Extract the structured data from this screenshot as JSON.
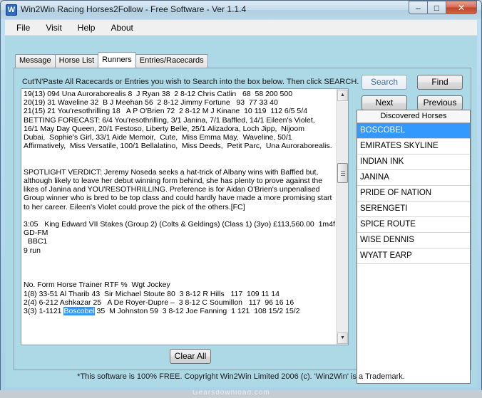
{
  "window": {
    "title": "Win2Win Racing Horses2Follow - Free Software - Ver 1.1.4",
    "minimize_glyph": "–",
    "maximize_glyph": "□",
    "close_glyph": "✕"
  },
  "menu": [
    "File",
    "Visit",
    "Help",
    "About"
  ],
  "tabs": [
    "Message",
    "Horse List",
    "Runners",
    "Entries/Racecards"
  ],
  "active_tab": "Runners",
  "runners": {
    "instruction": "Cut'N'Paste All Racecards or Entries you wish to Search into the box below. Then click SEARCH.",
    "text_before": "19(13) 094 Una Auroraborealis 8  J Ryan 38  2 8-12 Chris Catlin   68  58 200 500\n20(19) 31 Waveline 32  B J Meehan 56  2 8-12 Jimmy Fortune   93  77 33 40\n21(15) 21 You'resothrilling 18   A P O'Brien 72  2 8-12 M J Kinane  10 119  112 6/5 5/4\nBETTING FORECAST: 6/4 You'resothrilling, 3/1 Janina, 7/1 Baffled, 14/1 Eileen's Violet,\n16/1 May Day Queen, 20/1 Festoso, Liberty Belle, 25/1 Alizadora, Loch Jipp,  Nijoom\nDubai,  Sophie's Girl, 33/1 Aide Memoir,  Cute,  Miss Emma May,  Waveline, 50/1\nAffirmatively,  Miss Versatile, 100/1 Bellalatino,  Miss Deeds,  Petit Parc,  Una Auroraborealis.\n\n\nSPOTLIGHT VERDICT: Jeremy Noseda seeks a hat-trick of Albany wins with Baffled but,\nalthough likely to leave her debut winning form behind, she has plenty to prove against the\nlikes of Janina and YOU'RESOTHRILLING. Preference is for Aidan O'Brien's unpenalised\nGroup winner who is bred to be top class and could hardly have made a more promising start\nto her career. Eileen's Violet could prove the pick of the others.[FC]\n\n3:05   King Edward VII Stakes (Group 2) (Colts & Geldings) (Class 1) (3yo) £113,560.00  1m4f\nGD-FM\n  BBC1\n9 run\n\n\n\nNo. Form Horse Trainer RTF %  Wgt Jockey\n1(8) 33-51 Al Tharib 43  Sir Michael Stoute 80  3 8-12 R Hills   117  109 11 14\n2(4) 6-212 Ashkazar 25   A De Royer-Dupre –  3 8-12 C Soumillon   117  96 16 16\n3(3) 1-1121 ",
    "text_selected": "Boscobel",
    "text_after": " 35  M Johnston 59  3 8-12 Joe Fanning  1 121  108 15/2 15/2",
    "buttons": {
      "search": "Search",
      "find": "Find",
      "next": "Next",
      "previous": "Previous",
      "clear_all": "Clear All"
    },
    "discovered_header": "Discovered Horses",
    "discovered_horses": [
      "BOSCOBEL",
      "EMIRATES SKYLINE",
      "INDIAN INK",
      "JANINA",
      "PRIDE OF NATION",
      "SERENGETI",
      "SPICE ROUTE",
      "WISE DENNIS",
      "WYATT EARP"
    ],
    "selected_horse": "BOSCOBEL"
  },
  "footer": "*This software is 100% FREE. Copyright Win2Win Limited 2006 (c). 'Win2Win' is a Trademark.",
  "watermark": "Gearsdownload.com",
  "colors": {
    "window_bg": "#add8e6",
    "selection": "#3399ff"
  }
}
